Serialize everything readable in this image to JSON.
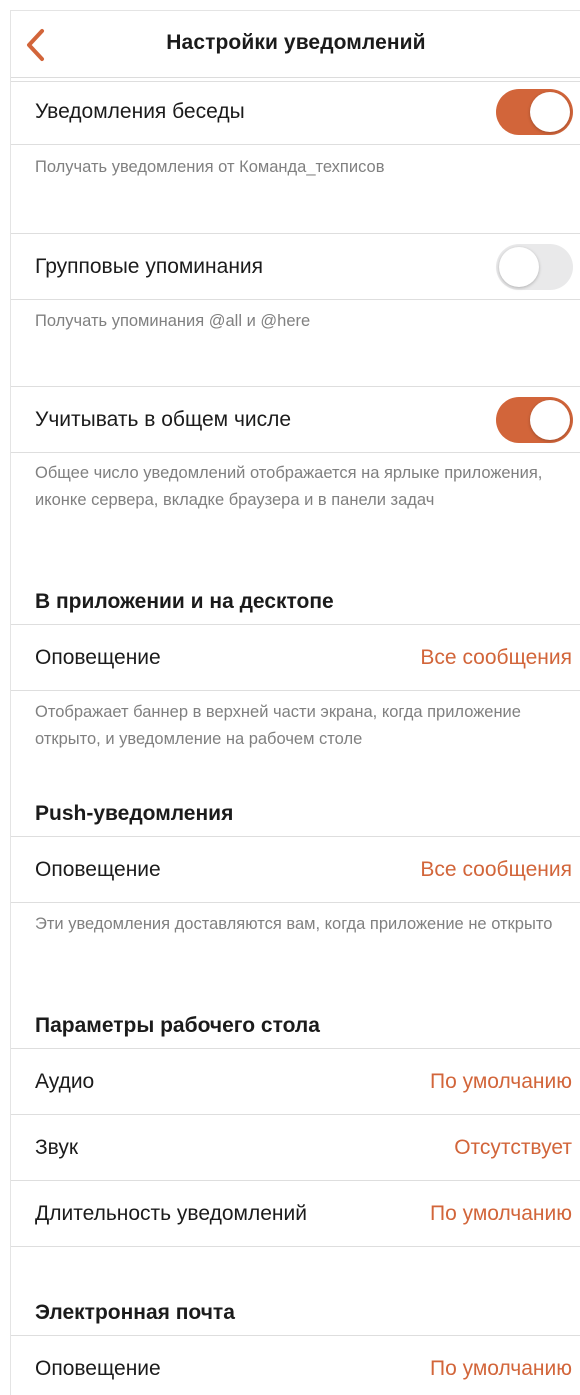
{
  "header": {
    "title": "Настройки уведомлений",
    "back_icon": "chevron-left-icon"
  },
  "colors": {
    "accent": "#d2653a",
    "toggle_off": "#e9e9ea",
    "text_primary": "#1b1b1b",
    "text_secondary": "#808080"
  },
  "conversation": {
    "label": "Уведомления беседы",
    "enabled": true,
    "note": "Получать уведомления от Команда_техписов"
  },
  "mentions": {
    "label": "Групповые упоминания",
    "enabled": false,
    "note": "Получать упоминания @all и @here"
  },
  "count": {
    "label": "Учитывать в общем числе",
    "enabled": true,
    "note": "Общее число уведомлений отображается на ярлыке приложения, иконке сервера, вкладке браузера и в панели задач"
  },
  "in_app": {
    "title": "В приложении и на десктопе",
    "alert_label": "Оповещение",
    "alert_value": "Все сообщения",
    "note": "Отображает баннер в верхней части экрана, когда приложение открыто, и уведомление на рабочем столе"
  },
  "push": {
    "title": "Push-уведомления",
    "alert_label": "Оповещение",
    "alert_value": "Все сообщения",
    "note": "Эти уведомления доставляются вам, когда приложение не открыто"
  },
  "desktop": {
    "title": "Параметры рабочего стола",
    "audio_label": "Аудио",
    "audio_value": "По умолчанию",
    "sound_label": "Звук",
    "sound_value": "Отсутствует",
    "duration_label": "Длительность уведомлений",
    "duration_value": "По умолчанию"
  },
  "email": {
    "title": "Электронная почта",
    "alert_label": "Оповещение",
    "alert_value": "По умолчанию"
  }
}
